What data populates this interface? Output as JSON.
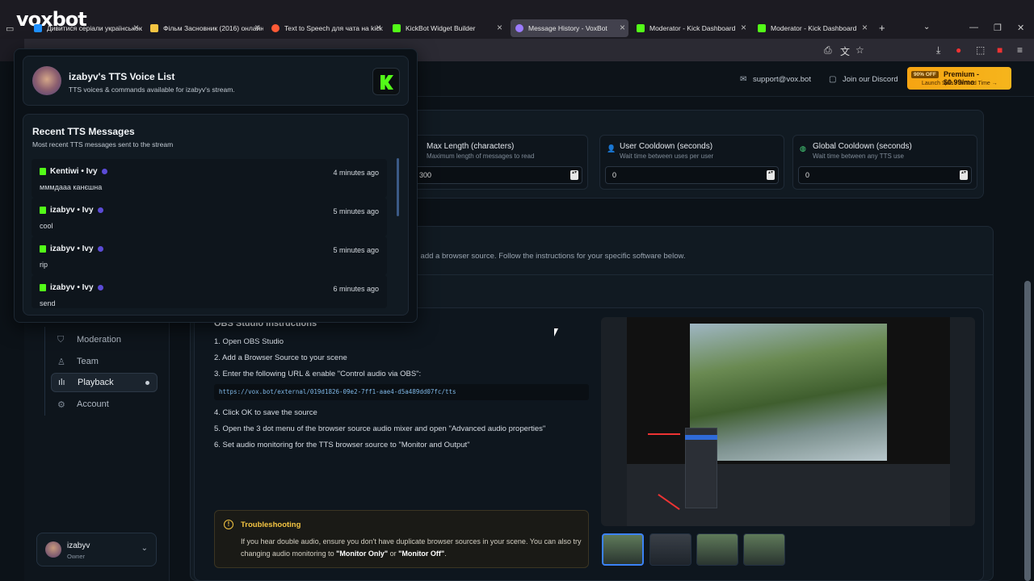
{
  "browser": {
    "brand": "voxbot",
    "tabs": [
      {
        "label": "Дивитися серіали українською",
        "icon_color": "#1e90ff"
      },
      {
        "label": "Фільм Засновник (2016) онлайн",
        "icon_color": "#f4c542"
      },
      {
        "label": "Text to Speech для чата на kick",
        "icon_color": "#ff5a36"
      },
      {
        "label": "KickBot Widget Builder",
        "icon_color": "#53fc18"
      },
      {
        "label": "Message History - VoxBot",
        "icon_color": "#9b7bff"
      },
      {
        "label": "Moderator - Kick Dashboard",
        "icon_color": "#53fc18"
      },
      {
        "label": "Moderator - Kick Dashboard",
        "icon_color": "#53fc18"
      }
    ],
    "new_tab": "+"
  },
  "header": {
    "support": "support@vox.bot",
    "discord": "Join our Discord",
    "promo": {
      "badge": "90% OFF",
      "title": "Premium - $0.99/mo",
      "sub": "Launch Sale - Limited Time →"
    }
  },
  "settings": {
    "max_length": {
      "title": "Max Length (characters)",
      "sub": "Maximum length of messages to read",
      "value": "300"
    },
    "user_cooldown": {
      "title": "User Cooldown (seconds)",
      "sub": "Wait time between uses per user",
      "value": "0"
    },
    "global_cooldown": {
      "title": "Global Cooldown (seconds)",
      "sub": "Wait time between any TTS use",
      "value": "0"
    }
  },
  "browser_source_note": "e, add a browser source. Follow the instructions for your specific software below.",
  "popup": {
    "title": "izabyv's TTS Voice List",
    "subtitle": "TTS voices & commands available for izabyv's stream.",
    "recent_title": "Recent TTS Messages",
    "recent_sub": "Most recent TTS messages sent to the stream",
    "messages": [
      {
        "user": "Kentiwi",
        "voice": "Ivy",
        "time": "4 minutes ago",
        "text": "мммдааа канєшна"
      },
      {
        "user": "izabyv",
        "voice": "Ivy",
        "time": "5 minutes ago",
        "text": "cool"
      },
      {
        "user": "izabyv",
        "voice": "Ivy",
        "time": "5 minutes ago",
        "text": "rip"
      },
      {
        "user": "izabyv",
        "voice": "Ivy",
        "time": "6 minutes ago",
        "text": "send"
      }
    ]
  },
  "sidebar": {
    "items": [
      {
        "label": "Moderation",
        "icon": "shield-icon"
      },
      {
        "label": "Team",
        "icon": "user-icon"
      },
      {
        "label": "Playback",
        "icon": "waveform-icon"
      },
      {
        "label": "Account",
        "icon": "gear-icon"
      }
    ],
    "user": {
      "name": "izabyv",
      "role": "Owner"
    }
  },
  "obs": {
    "title": "OBS Studio Instructions",
    "steps": [
      "1. Open OBS Studio",
      "2. Add a Browser Source to your scene",
      "3. Enter the following URL & enable \"Control audio via OBS\":",
      "4. Click OK to save the source",
      "5. Open the 3 dot menu of the browser source audio mixer and open \"Advanced audio properties\"",
      "6. Set audio monitoring for the TTS browser source to \"Monitor and Output\""
    ],
    "url": "https://vox.bot/external/019d1826-09e2-7ff1-aae4-d5a489dd07fc/tts",
    "trouble_title": "Troubleshooting",
    "trouble_text": "If you hear double audio, ensure you don't have duplicate browser sources in your scene. You can also try changing audio monitoring to",
    "trouble_a": "\"Monitor Only\"",
    "trouble_or": " or ",
    "trouble_b": "\"Monitor Off\"",
    "trouble_end": "."
  },
  "colors": {
    "kick_green": "#53fc18",
    "accent": "#f6a412"
  }
}
